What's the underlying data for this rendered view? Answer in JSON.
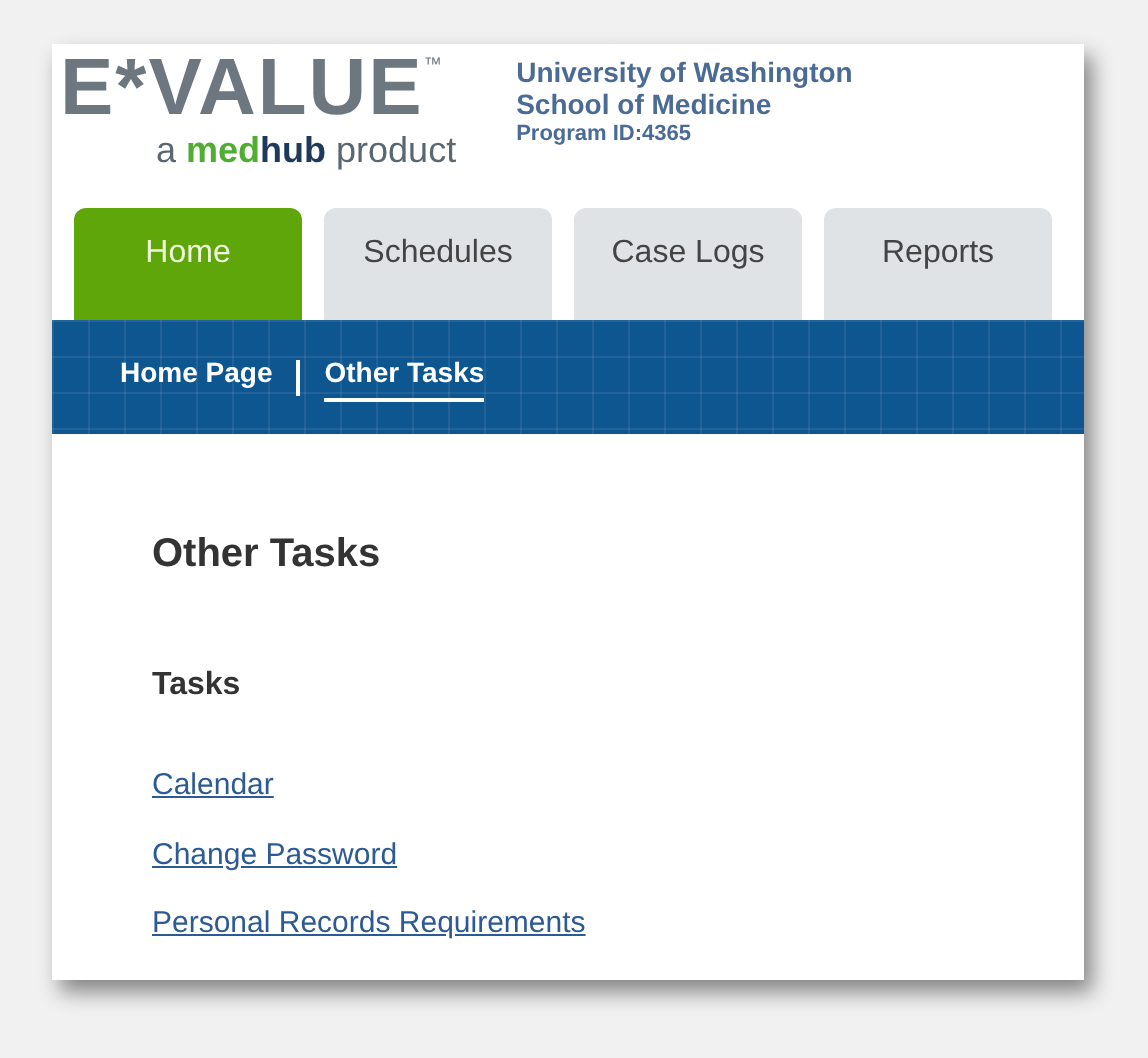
{
  "logo": {
    "wordmark": "E*VALUE",
    "trademark": "™",
    "tagline_prefix": "a",
    "brand_med": "med",
    "brand_hub": "hub",
    "tagline_suffix": "product"
  },
  "institution": {
    "name_line_1": "University of Washington",
    "name_line_2": "School of Medicine",
    "program_id": "Program ID:4365"
  },
  "tabs": [
    {
      "label": "Home",
      "selected": true
    },
    {
      "label": "Schedules",
      "selected": false
    },
    {
      "label": "Case Logs",
      "selected": false
    },
    {
      "label": "Reports",
      "selected": false
    }
  ],
  "breadcrumbs": [
    {
      "label": "Home Page",
      "selected": false
    },
    {
      "label": "Other Tasks",
      "selected": true
    }
  ],
  "page_title": "Other Tasks",
  "section_title": "Tasks",
  "links": [
    "Calendar",
    "Change Password",
    "Personal Records Requirements"
  ]
}
